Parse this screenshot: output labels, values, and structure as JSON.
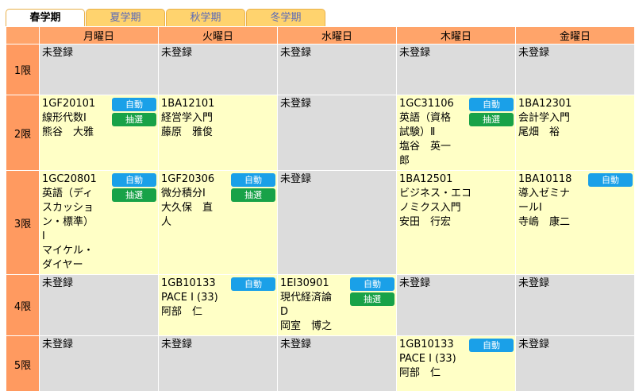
{
  "tabs": [
    {
      "label": "春学期",
      "active": true
    },
    {
      "label": "夏学期",
      "active": false
    },
    {
      "label": "秋学期",
      "active": false
    },
    {
      "label": "冬学期",
      "active": false
    }
  ],
  "days": [
    "月曜日",
    "火曜日",
    "水曜日",
    "木曜日",
    "金曜日"
  ],
  "periods": [
    "1限",
    "2限",
    "3限",
    "4限",
    "5限"
  ],
  "empty_label": "未登録",
  "badge_labels": {
    "auto": "自動",
    "lottery": "抽選"
  },
  "rows": [
    {
      "height": 64,
      "cells": [
        {
          "empty": true
        },
        {
          "empty": true
        },
        {
          "empty": true
        },
        {
          "empty": true
        },
        {
          "empty": true
        }
      ]
    },
    {
      "height": 94,
      "cells": [
        {
          "code": "1GF20101",
          "lines": [
            "線形代数Ⅰ",
            "熊谷　大雅"
          ],
          "badges": [
            "auto",
            "lottery"
          ]
        },
        {
          "code": "1BA12101",
          "lines": [
            "経営学入門",
            "藤原　雅俊"
          ],
          "badges": []
        },
        {
          "empty": true
        },
        {
          "code": "1GC31106",
          "lines": [
            "英語（資格",
            "試験）Ⅱ",
            "塩谷　英一",
            "郎"
          ],
          "badges": [
            "auto",
            "lottery"
          ]
        },
        {
          "code": "1BA12301",
          "lines": [
            "会計学入門",
            "尾畑　裕"
          ],
          "badges": []
        }
      ]
    },
    {
      "height": 130,
      "cells": [
        {
          "code": "1GC20801",
          "lines": [
            "英語（ディ",
            "スカッショ",
            "ン・標準）",
            "Ⅰ",
            "マイケル・",
            "ダイヤー"
          ],
          "badges": [
            "auto",
            "lottery"
          ]
        },
        {
          "code": "1GF20306",
          "lines": [
            "微分積分Ⅰ",
            "大久保　直",
            "人"
          ],
          "badges": [
            "auto",
            "lottery"
          ]
        },
        {
          "empty": true
        },
        {
          "code": "1BA12501",
          "lines": [
            "ビジネス・エコ",
            "ノミクス入門",
            "安田　行宏"
          ],
          "badges": []
        },
        {
          "code": "1BA10118",
          "lines": [
            "導入ゼミナ",
            "ールⅠ",
            "寺嶋　康二"
          ],
          "badges": [
            "auto"
          ]
        }
      ]
    },
    {
      "height": 76,
      "cells": [
        {
          "empty": true
        },
        {
          "code": "1GB10133",
          "lines": [
            "PACE I (33)",
            "阿部　仁"
          ],
          "badges": [
            "auto"
          ]
        },
        {
          "code": "1EI30901",
          "lines": [
            "現代経済論",
            "D",
            "岡室　博之"
          ],
          "badges": [
            "auto",
            "lottery"
          ]
        },
        {
          "empty": true
        },
        {
          "empty": true
        }
      ]
    },
    {
      "height": 72,
      "cells": [
        {
          "empty": true
        },
        {
          "empty": true
        },
        {
          "empty": true
        },
        {
          "code": "1GB10133",
          "lines": [
            "PACE I (33)",
            "阿部　仁"
          ],
          "badges": [
            "auto"
          ]
        },
        {
          "empty": true
        }
      ]
    }
  ]
}
